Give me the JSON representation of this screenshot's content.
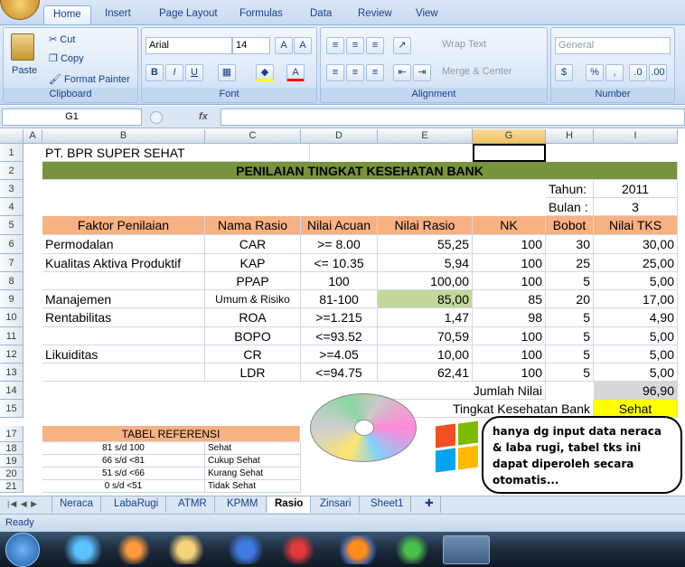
{
  "ribbon": {
    "tabs": [
      "Home",
      "Insert",
      "Page Layout",
      "Formulas",
      "Data",
      "Review",
      "View"
    ],
    "active_tab": "Home",
    "clipboard": {
      "paste": "Paste",
      "cut": "Cut",
      "copy": "Copy",
      "format_painter": "Format Painter",
      "label": "Clipboard"
    },
    "font": {
      "name": "Arial",
      "size": "14",
      "label": "Font"
    },
    "alignment": {
      "wrap": "Wrap Text",
      "merge": "Merge & Center",
      "label": "Alignment"
    },
    "number": {
      "format": "General",
      "label": "Number",
      "percent": "%",
      "comma": ","
    }
  },
  "formula_bar": {
    "name_box": "G1",
    "fx": "fx",
    "value": ""
  },
  "columns": [
    "A",
    "B",
    "C",
    "D",
    "E",
    "G",
    "H",
    "I"
  ],
  "rows": [
    "1",
    "2",
    "3",
    "4",
    "5",
    "6",
    "7",
    "8",
    "9",
    "10",
    "11",
    "12",
    "13",
    "14",
    "15",
    "17",
    "18",
    "19",
    "20",
    "21"
  ],
  "sheet": {
    "company": "PT. BPR SUPER SEHAT",
    "title": "PENILAIAN TINGKAT KESEHATAN BANK",
    "tahun_label": "Tahun:",
    "tahun_value": "2011",
    "bulan_label": "Bulan :",
    "bulan_value": "3",
    "headers": [
      "Faktor Penilaian",
      "Nama Rasio",
      "Nilai Acuan",
      "Nilai Rasio",
      "NK",
      "Bobot",
      "Nilai TKS"
    ],
    "data": [
      [
        "Permodalan",
        "CAR",
        ">= 8.00",
        "55,25",
        "100",
        "30",
        "30,00"
      ],
      [
        "Kualitas Aktiva Produktif",
        "KAP",
        "<= 10.35",
        "5,94",
        "100",
        "25",
        "25,00"
      ],
      [
        "",
        "PPAP",
        "100",
        "100,00",
        "100",
        "5",
        "5,00"
      ],
      [
        "Manajemen",
        "Umum & Risiko",
        "81-100",
        "85,00",
        "85",
        "20",
        "17,00"
      ],
      [
        "Rentabilitas",
        "ROA",
        ">=1.215",
        "1,47",
        "98",
        "5",
        "4,90"
      ],
      [
        "",
        "BOPO",
        "<=93.52",
        "70,59",
        "100",
        "5",
        "5,00"
      ],
      [
        "Likuiditas",
        "CR",
        ">=4.05",
        "10,00",
        "100",
        "5",
        "5,00"
      ],
      [
        "",
        "LDR",
        "<=94.75",
        "62,41",
        "100",
        "5",
        "5,00"
      ]
    ],
    "jumlah_label": "Jumlah Nilai",
    "jumlah_value": "96,90",
    "tingkat_label": "Tingkat Kesehatan Bank",
    "tingkat_value": "Sehat",
    "ref_title": "TABEL REFERENSI",
    "ref": [
      [
        "81 s/d 100",
        "Sehat"
      ],
      [
        "66 s/d <81",
        "Cukup Sehat"
      ],
      [
        "51 s/d <66",
        "Kurang Sehat"
      ],
      [
        "0  s/d <51",
        "Tidak Sehat"
      ]
    ]
  },
  "callout": "hanya dg input data neraca & laba rugi, tabel tks ini dapat diperoleh secara otomatis...",
  "sheet_tabs": [
    "Neraca",
    "LabaRugi",
    "ATMR",
    "KPMM",
    "Rasio",
    "Zinsari",
    "Sheet1"
  ],
  "active_sheet": "Rasio",
  "status": "Ready",
  "colors": {
    "header_fill": "#f8b183",
    "title_fill": "#77933c",
    "highlight": "#c3d69b",
    "sehat": "#ffff00",
    "jumlah": "#d8d8d8"
  }
}
